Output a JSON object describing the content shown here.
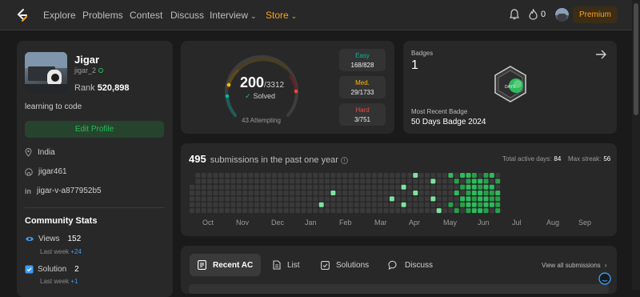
{
  "nav": {
    "items": [
      "Explore",
      "Problems",
      "Contest",
      "Discuss",
      "Interview",
      "Store"
    ],
    "fire_count": "0",
    "premium_label": "Premium"
  },
  "colors": {
    "accent": "#ffa116",
    "green": "#2cbb5d",
    "easy": "#00b8a3",
    "medium": "#ffb800",
    "hard": "#ef4743",
    "link": "#3d9df6"
  },
  "profile": {
    "name": "Jigar",
    "handle": "jigar_2",
    "rank_label": "Rank",
    "rank": "520,898",
    "bio": "learning to code",
    "edit_label": "Edit Profile",
    "location": "India",
    "github": "jigar461",
    "linkedin": "jigar-v-a877952b5"
  },
  "community": {
    "title": "Community Stats",
    "views_label": "Views",
    "views": "152",
    "views_last_week_label": "Last week",
    "views_delta": "+24",
    "solution_label": "Solution",
    "solution": "2",
    "solution_last_week_label": "Last week",
    "solution_delta": "+1"
  },
  "solved": {
    "count": "200",
    "total": "/3312",
    "solved_label": "Solved",
    "attempting": "43 Attempting",
    "easy_label": "Easy",
    "easy": "168/828",
    "medium_label": "Med.",
    "medium": "29/1733",
    "hard_label": "Hard",
    "hard": "3/751"
  },
  "badges": {
    "label": "Badges",
    "count": "1",
    "recent_label": "Most Recent Badge",
    "recent": "50 Days Badge 2024",
    "badge_text": "DAYS"
  },
  "submissions": {
    "count": "495",
    "label": "submissions in the past one year",
    "active_days_label": "Total active days:",
    "active_days": "84",
    "max_streak_label": "Max streak:",
    "max_streak": "56",
    "months": [
      "Oct",
      "Nov",
      "Dec",
      "Jan",
      "Feb",
      "Mar",
      "Apr",
      "May",
      "Jun",
      "Jul",
      "Aug",
      "Sep"
    ]
  },
  "tabs": {
    "items": [
      "Recent AC",
      "List",
      "Solutions",
      "Discuss"
    ],
    "view_all": "View all submissions"
  }
}
